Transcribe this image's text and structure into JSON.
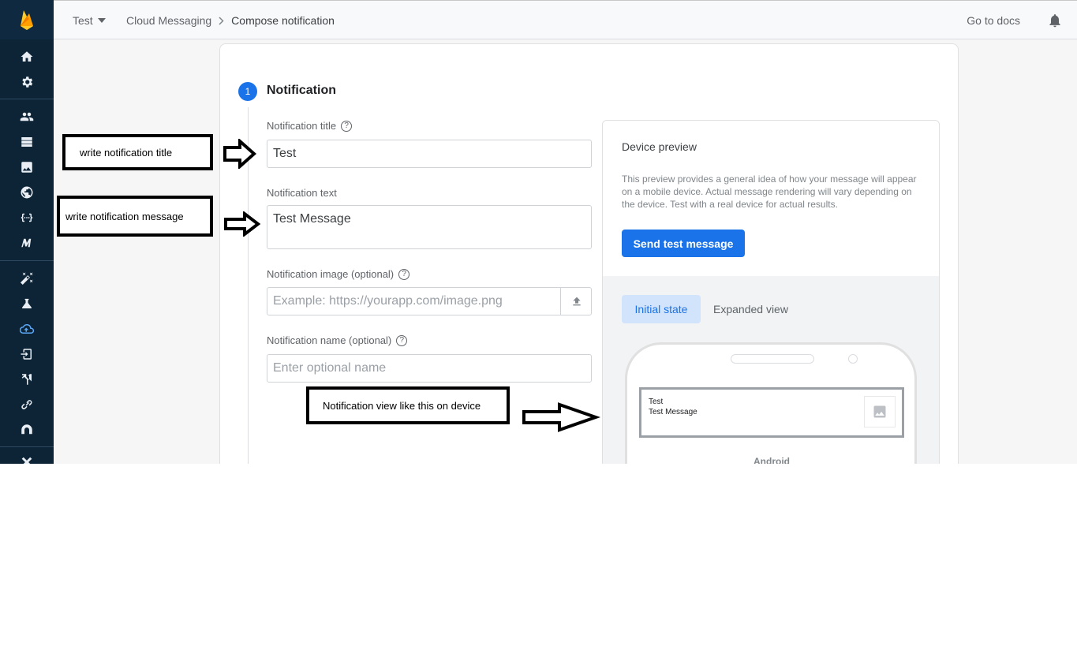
{
  "topbar": {
    "project": "Test",
    "breadcrumb_service": "Cloud Messaging",
    "breadcrumb_page": "Compose notification",
    "docs_link": "Go to docs"
  },
  "sidebar": {
    "icons": [
      "home-icon",
      "settings-icon",
      "users-icon",
      "database-icon",
      "storage-icon",
      "hosting-icon",
      "functions-icon",
      "ml-icon",
      "predictions-icon",
      "test-lab-icon",
      "cloud-messaging-icon",
      "in-app-messaging-icon",
      "ab-testing-icon",
      "dynamic-links-icon",
      "app-distribution-icon"
    ],
    "active": "cloud-messaging-icon"
  },
  "compose": {
    "step_number": "1",
    "step_title": "Notification",
    "title_label": "Notification title",
    "title_value": "Test",
    "text_label": "Notification text",
    "text_value": "Test Message",
    "image_label": "Notification image (optional)",
    "image_placeholder": "Example: https://yourapp.com/image.png",
    "name_label": "Notification name (optional)",
    "name_placeholder": "Enter optional name",
    "help_glyph": "?"
  },
  "preview": {
    "title": "Device preview",
    "description": "This preview provides a general idea of how your message will appear on a mobile device. Actual message rendering will vary depending on the device. Test with a real device for actual results.",
    "send_button": "Send test message",
    "tab_initial": "Initial state",
    "tab_expanded": "Expanded view",
    "notification_title": "Test",
    "notification_text": "Test Message",
    "platform_label": "Android"
  },
  "annotations": {
    "title_note": "write notification title",
    "message_note": "write notification message",
    "device_note": "Notification view like this on device"
  },
  "colors": {
    "sidebar": "#0d2437",
    "accent": "#1a73e8",
    "active_icon": "#5ba7f6"
  }
}
